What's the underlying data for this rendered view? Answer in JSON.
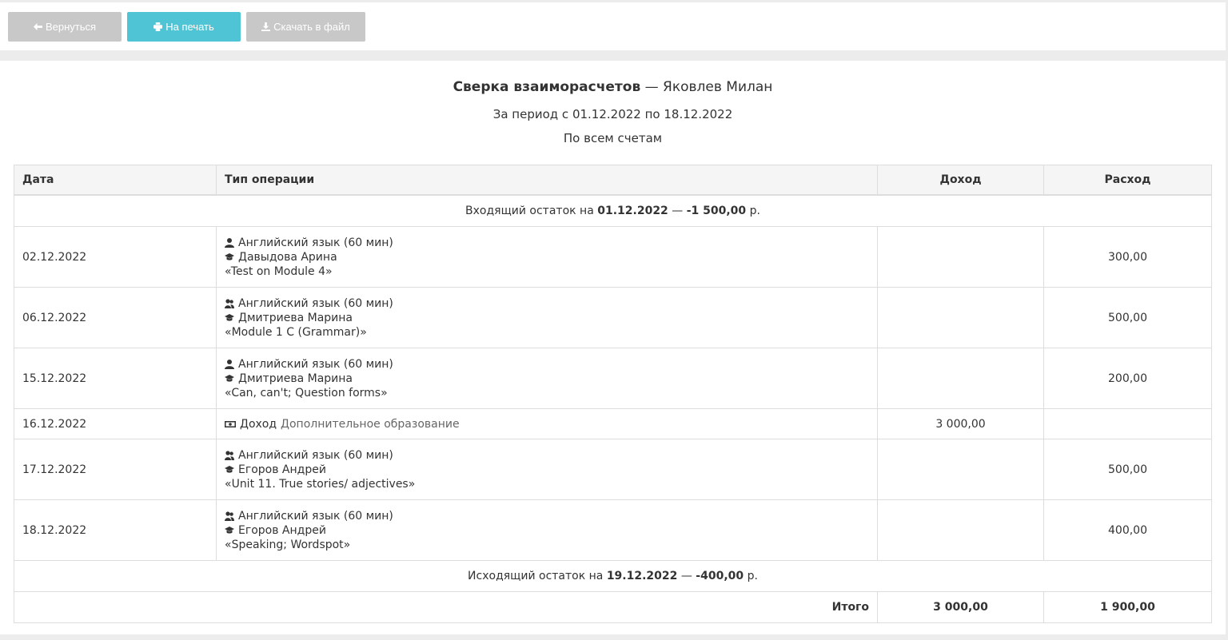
{
  "toolbar": {
    "back_label": "Вернуться",
    "print_label": "На печать",
    "download_label": "Скачать в файл"
  },
  "report": {
    "title": "Сверка взаиморасчетов",
    "dash": "—",
    "person": "Яковлев Милан",
    "period": "За период с 01.12.2022 по 18.12.2022",
    "scope": "По всем счетам"
  },
  "table": {
    "headers": {
      "date": "Дата",
      "type": "Тип операции",
      "income": "Доход",
      "expense": "Расход"
    },
    "opening": {
      "prefix": "Входящий остаток на",
      "date": "01.12.2022",
      "sep": "—",
      "amount": "-1 500,00",
      "suffix": "р."
    },
    "rows": [
      {
        "date": "02.12.2022",
        "course": "Английский язык (60 мин)",
        "course_icon": "user-icon",
        "teacher": "Давыдова Арина",
        "topic": "«Test on Module 4»",
        "income": "",
        "expense": "300,00"
      },
      {
        "date": "06.12.2022",
        "course": "Английский язык (60 мин)",
        "course_icon": "users-icon",
        "teacher": "Дмитриева Марина",
        "topic": "«Module 1 C (Grammar)»",
        "income": "",
        "expense": "500,00"
      },
      {
        "date": "15.12.2022",
        "course": "Английский язык (60 мин)",
        "course_icon": "user-icon",
        "teacher": "Дмитриева Марина",
        "topic": "«Can, can't; Question forms»",
        "income": "",
        "expense": "200,00"
      },
      {
        "date": "17.12.2022",
        "course": "Английский язык (60 мин)",
        "course_icon": "users-icon",
        "teacher": "Егоров Андрей",
        "topic": "«Unit 11. True stories/ adjectives»",
        "income": "",
        "expense": "500,00"
      },
      {
        "date": "18.12.2022",
        "course": "Английский язык (60 мин)",
        "course_icon": "users-icon",
        "teacher": "Егоров Андрей",
        "topic": "«Speaking; Wordspot»",
        "income": "",
        "expense": "400,00"
      }
    ],
    "income_row": {
      "date": "16.12.2022",
      "label": "Доход",
      "category": "Дополнительное образование",
      "income": "3 000,00",
      "expense": ""
    },
    "closing": {
      "prefix": "Исходящий остаток на",
      "date": "19.12.2022",
      "sep": "—",
      "amount": "-400,00",
      "suffix": "р."
    },
    "totals": {
      "label": "Итого",
      "income": "3 000,00",
      "expense": "1 900,00"
    }
  }
}
